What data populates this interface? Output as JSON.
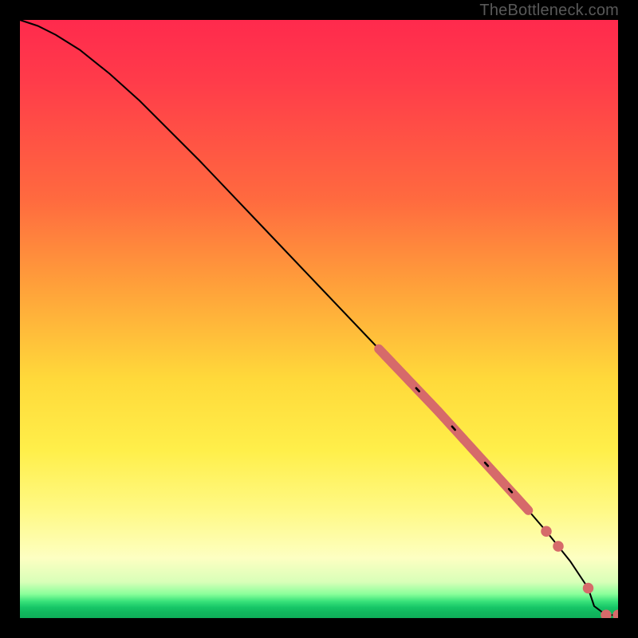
{
  "watermark": "TheBottleneck.com",
  "colors": {
    "page_bg": "#000000",
    "curve": "#000000",
    "marker": "#d66a6a",
    "watermark": "#595959"
  },
  "chart_data": {
    "type": "line",
    "title": "",
    "xlabel": "",
    "ylabel": "",
    "xlim": [
      0,
      100
    ],
    "ylim": [
      0,
      100
    ],
    "grid": false,
    "legend": false,
    "series": [
      {
        "name": "curve",
        "x": [
          0,
          3,
          6,
          10,
          15,
          20,
          30,
          40,
          50,
          60,
          70,
          75,
          80,
          85,
          88,
          90,
          92,
          94,
          95,
          96,
          98,
          100
        ],
        "y": [
          100,
          99,
          97.5,
          95,
          91,
          86.5,
          76.5,
          66,
          55.5,
          45,
          34.5,
          29,
          23.5,
          18,
          14.5,
          12,
          9.5,
          6.5,
          5,
          2,
          0.5,
          0.5
        ]
      }
    ],
    "markers": [
      {
        "series": "curve",
        "x_range": [
          60,
          85
        ],
        "style": "dense-segment"
      },
      {
        "series": "curve",
        "x": 88,
        "style": "point"
      },
      {
        "series": "curve",
        "x": 90,
        "style": "point"
      },
      {
        "series": "curve",
        "x": 95,
        "style": "point"
      },
      {
        "series": "curve",
        "x": 98,
        "style": "point"
      },
      {
        "series": "curve",
        "x": 100,
        "style": "point"
      }
    ]
  }
}
